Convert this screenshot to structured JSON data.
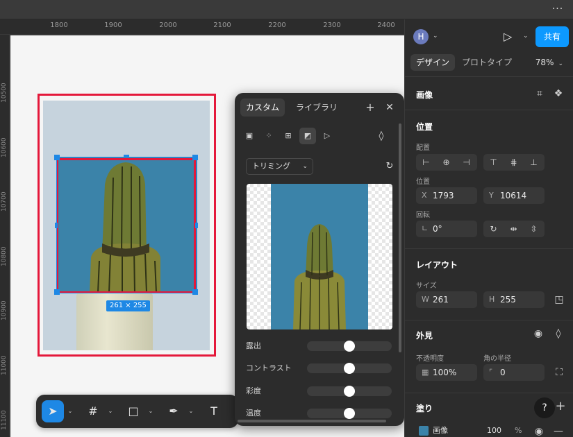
{
  "topbar": {
    "more_glyph": "···"
  },
  "ruler": {
    "x_ticks": [
      "1800",
      "1900",
      "2000",
      "2100",
      "2200",
      "2300",
      "2400"
    ],
    "y_ticks": [
      "10500",
      "10600",
      "10700",
      "10800",
      "10900",
      "11000",
      "11100"
    ]
  },
  "canvas": {
    "size_badge": "261 × 255"
  },
  "toolbar": {
    "tools": [
      {
        "name": "move-tool",
        "glyph": "➤"
      },
      {
        "name": "frame-tool",
        "glyph": "#"
      },
      {
        "name": "shape-tool",
        "glyph": "□"
      },
      {
        "name": "pen-tool",
        "glyph": "✒"
      },
      {
        "name": "text-tool",
        "glyph": "T"
      }
    ],
    "caret": "⌄"
  },
  "fill_popup": {
    "tabs": [
      "カスタム",
      "ライブラリ"
    ],
    "add_glyph": "+",
    "close_glyph": "✕",
    "fill_type_icons": [
      "solid-fill-icon",
      "gradient-fill-icon",
      "pattern-fill-icon",
      "image-fill-icon",
      "video-fill-icon"
    ],
    "blend_icon": "drop-icon",
    "mode": "トリミング",
    "adjustments": [
      {
        "label": "露出",
        "value": 0.5
      },
      {
        "label": "コントラスト",
        "value": 0.5
      },
      {
        "label": "彩度",
        "value": 0.5
      },
      {
        "label": "温度",
        "value": 0.5
      }
    ]
  },
  "panel": {
    "avatar_initial": "H",
    "share_label": "共有",
    "tabs": [
      "デザイン",
      "プロトタイプ"
    ],
    "zoom": "78%",
    "image_section": "画像",
    "position_section": "位置",
    "align_label": "配置",
    "position_label": "位置",
    "x_prefix": "X",
    "x_value": "1793",
    "y_prefix": "Y",
    "y_value": "10614",
    "rotation_label": "回転",
    "rotation_value": "0°",
    "layout_section": "レイアウト",
    "size_label": "サイズ",
    "w_prefix": "W",
    "w_value": "261",
    "h_prefix": "H",
    "h_value": "255",
    "appearance_section": "外見",
    "opacity_label": "不透明度",
    "opacity_value": "100%",
    "radius_label": "角の半径",
    "radius_value": "0",
    "fill_section": "塗り",
    "fill_name": "画像",
    "fill_opacity": "100",
    "fill_unit": "%",
    "help_glyph": "?",
    "accent": "#0d99ff"
  }
}
